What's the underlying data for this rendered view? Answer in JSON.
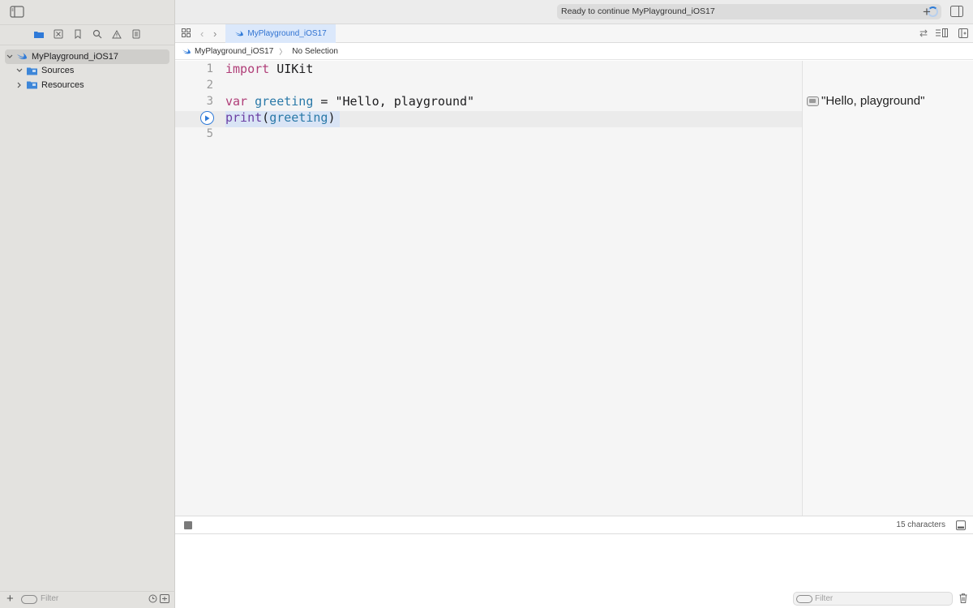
{
  "window": {
    "status_text": "Ready to continue MyPlayground_iOS17",
    "add_icon": "plus-icon"
  },
  "sidebar": {
    "nav_icons": [
      "folder-icon",
      "source-control-icon",
      "bookmark-icon",
      "search-icon",
      "warning-icon",
      "report-icon"
    ],
    "tree": [
      {
        "label": "MyPlayground_iOS17",
        "icon": "swift-icon",
        "expanded": true,
        "selected": true
      },
      {
        "label": "Sources",
        "icon": "folder-icon",
        "expanded": true,
        "selected": false
      },
      {
        "label": "Resources",
        "icon": "folder-icon",
        "expanded": false,
        "selected": false
      }
    ],
    "filter_placeholder": "Filter"
  },
  "tabbar": {
    "active_tab": "MyPlayground_iOS17"
  },
  "breadcrumb": {
    "file": "MyPlayground_iOS17",
    "selection": "No Selection"
  },
  "editor": {
    "line_numbers": [
      "1",
      "2",
      "3",
      "",
      "5"
    ],
    "lines": {
      "l1_kw": "import",
      "l1_rest": " UIKit",
      "l3_kw": "var",
      "l3_var": " greeting",
      "l3_op": " = ",
      "l3_str": "\"Hello, playground\"",
      "l4_fn": "print",
      "l4_open": "(",
      "l4_arg": "greeting",
      "l4_close": ")"
    }
  },
  "results": {
    "value": "\"Hello, playground\""
  },
  "debug": {
    "char_count": "15 characters"
  },
  "console": {
    "filter_placeholder": "Filter"
  },
  "colors": {
    "accent": "#2f7ad8",
    "keyword": "#b03e78",
    "identifier": "#2a79a8"
  }
}
